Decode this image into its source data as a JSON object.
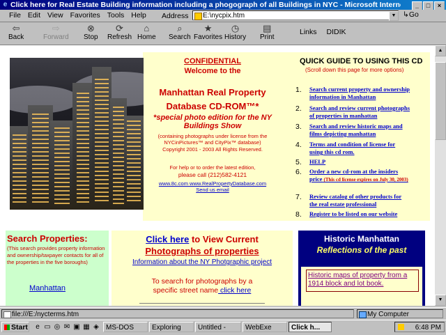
{
  "window": {
    "title": "Click here for Real Estate Building information including a phogograph of all Buildings in NYC - Microsoft Internet Explorer",
    "controls": [
      "_",
      "□",
      "×"
    ]
  },
  "menu": [
    "File",
    "Edit",
    "View",
    "Favorites",
    "Tools",
    "Help"
  ],
  "address": {
    "label": "Address",
    "value": "E:\\nycpix.htm",
    "go": "Go"
  },
  "toolbar": {
    "buttons": [
      "Back",
      "Forward",
      "Stop",
      "Refresh",
      "Home",
      "Search",
      "Favorites",
      "History",
      "Print"
    ]
  },
  "links": {
    "label": "Links",
    "item": "DIDIK"
  },
  "content": {
    "confidential": "CONFIDENTIAL",
    "welcome": "Welcome to the",
    "db_title_1": "Manhattan Real Property",
    "db_title_2": "Database CD-ROM™*",
    "special_1": "*special photo edition for the NY",
    "special_2": "Buildings Show",
    "license_1": "(containing photographs under license from the",
    "license_2": "NYCinPictures™ and CityPix™ database)",
    "copyright": "Copyright 2001 - 2003 All Rights Reserved.",
    "help_1": "For help or to order the latest edition,",
    "help_2": "please call (212)582-4121",
    "website": "www.8c.com www.RealPropertyDatabase.com",
    "email": "Send us email",
    "quide": {
      "title": "QUICK GUIDE TO USING THIS CD",
      "subtitle": "(Scroll down this page for more options)",
      "items": [
        {
          "num": "1.",
          "lines": [
            "Search current property and ownership",
            "information in Manhattan"
          ]
        },
        {
          "num": "2.",
          "lines": [
            "Search and review current photographs",
            "of properties in manhattan"
          ]
        },
        {
          "num": "3.",
          "lines": [
            "Search and review historic maps and",
            "films depicting manhattan"
          ]
        },
        {
          "num": "4.",
          "lines": [
            "Terms and condition of license for",
            "using this cd rom."
          ]
        },
        {
          "num": "5.",
          "lines": [
            "HELP"
          ]
        },
        {
          "num": "6.",
          "lines": [
            "Order a new cd-rom at the insiders",
            "price"
          ],
          "note": "(This cd license expires on July 30, 2003)"
        },
        {
          "num": "7.",
          "lines": [
            "Review catalog of other products for",
            "the real estate professional"
          ]
        },
        {
          "num": "8.",
          "lines": [
            "Register to be listed on our website"
          ]
        }
      ]
    },
    "search": {
      "title": "Search Properties:",
      "desc": "(This search provides property information and ownership/taxpayer contacts for all of the properties in the five boroughs)",
      "link": "Manhattan"
    },
    "photos": {
      "click_here": "Click here",
      "title_rest": " to View Current",
      "title_line2": "Photographs of properties",
      "info_link": "Information about the NY Photgraphic project",
      "street_1": "To search for photographs by a",
      "street_2": "specific street name",
      "street_link": " click here"
    },
    "historic": {
      "title": "Historic Manhattan",
      "subtitle": "Reflections of the past",
      "link": "Historic maps of property from a 1914 block and lot book."
    }
  },
  "status": {
    "text": "file:///E:/nycterms.htm",
    "zone": "My Computer"
  },
  "taskbar": {
    "start": "Start",
    "tasks": [
      "MS-DOS",
      "Exploring",
      "Untitled -",
      "WebExe",
      "Click h..."
    ],
    "time": "6:48 PM"
  }
}
